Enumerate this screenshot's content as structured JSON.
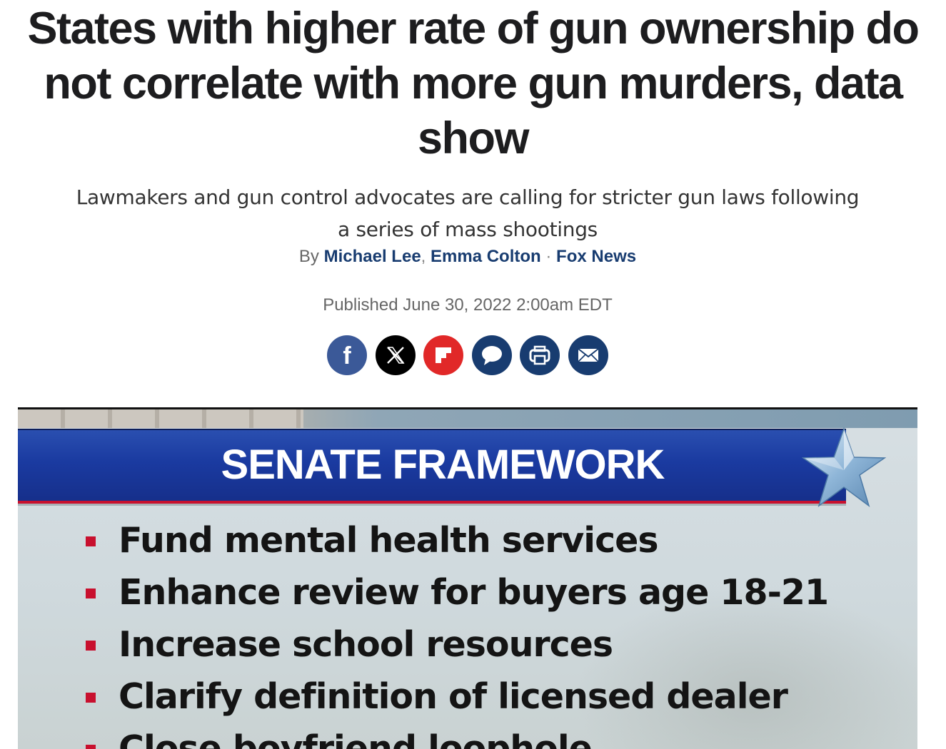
{
  "article": {
    "headline": "States with higher rate of gun ownership do not correlate with more gun murders, data show",
    "subheadline": "Lawmakers and gun control advocates are calling for stricter gun laws following a series of mass shootings",
    "byline": {
      "prefix": "By",
      "authors": [
        "Michael Lee",
        "Emma Colton"
      ],
      "comma": ",",
      "separator": "·",
      "source": "Fox News"
    },
    "published": "Published June 30, 2022 2:00am EDT"
  },
  "share": [
    {
      "name": "facebook-icon",
      "color": "#3b5998"
    },
    {
      "name": "x-icon",
      "color": "#000000"
    },
    {
      "name": "flipboard-icon",
      "color": "#e12828"
    },
    {
      "name": "comments-icon",
      "color": "#183c70"
    },
    {
      "name": "print-icon",
      "color": "#183c70"
    },
    {
      "name": "email-icon",
      "color": "#183c70"
    }
  ],
  "hero_image": {
    "banner_title": "SENATE FRAMEWORK",
    "bullets": [
      "Fund mental health services",
      "Enhance review for buyers age 18-21",
      "Increase school resources",
      "Clarify definition of licensed dealer",
      "Close boyfriend loophole"
    ],
    "banner_color": "#1a3aa0",
    "bullet_color": "#c8102e"
  }
}
